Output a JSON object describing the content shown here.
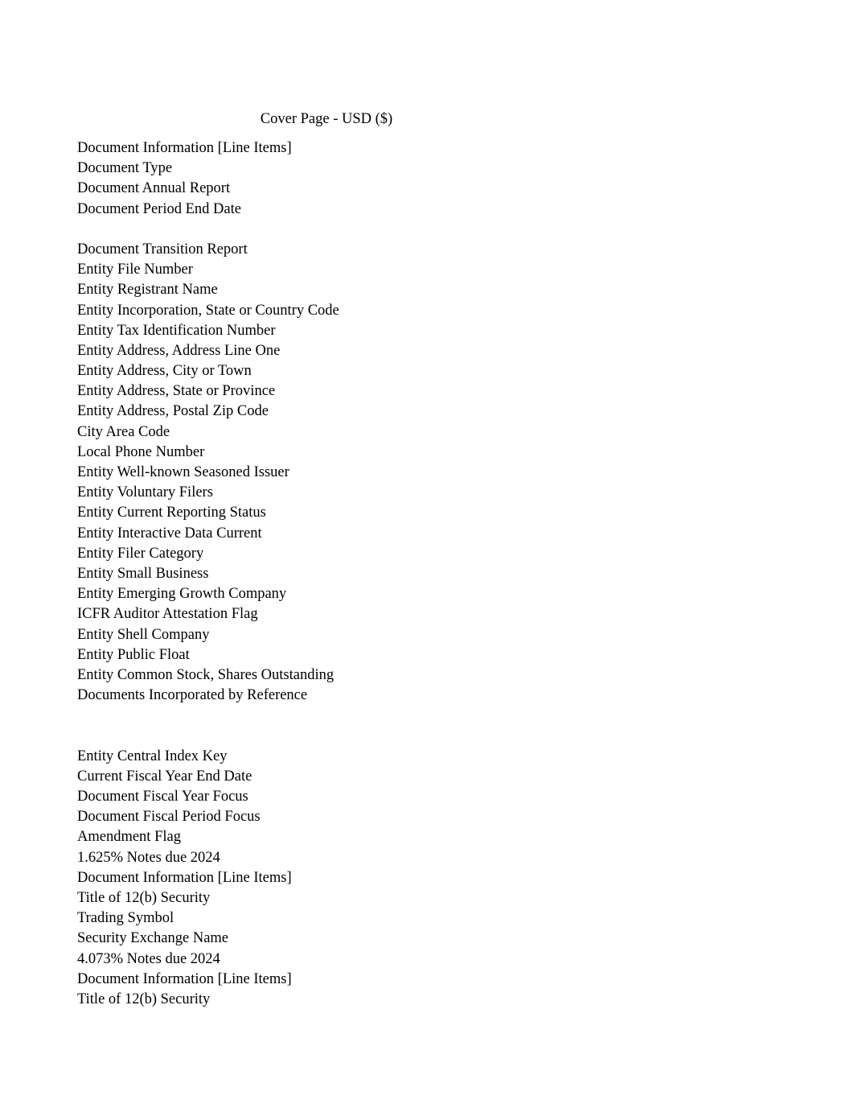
{
  "page": {
    "title": "Cover Page - USD ($)",
    "background_color": "#ffffff",
    "text_color": "#000000"
  },
  "rows": [
    {
      "label": "Document Information [Line Items]",
      "type": "label"
    },
    {
      "label": "Document Type",
      "type": "label"
    },
    {
      "label": "Document Annual Report",
      "type": "label"
    },
    {
      "label": "Document Period End Date",
      "type": "label"
    },
    {
      "label": "",
      "type": "spacer"
    },
    {
      "label": "Document Transition Report",
      "type": "label"
    },
    {
      "label": "Entity File Number",
      "type": "label"
    },
    {
      "label": "Entity Registrant Name",
      "type": "label"
    },
    {
      "label": "Entity Incorporation, State or Country Code",
      "type": "label"
    },
    {
      "label": "Entity Tax Identification Number",
      "type": "label"
    },
    {
      "label": "Entity Address, Address Line One",
      "type": "label"
    },
    {
      "label": "Entity Address, City or Town",
      "type": "label"
    },
    {
      "label": "Entity Address, State or Province",
      "type": "label"
    },
    {
      "label": "Entity Address, Postal Zip Code",
      "type": "label"
    },
    {
      "label": "City Area Code",
      "type": "label"
    },
    {
      "label": "Local Phone Number",
      "type": "label"
    },
    {
      "label": "Entity Well-known Seasoned Issuer",
      "type": "label"
    },
    {
      "label": "Entity Voluntary Filers",
      "type": "label"
    },
    {
      "label": "Entity Current Reporting Status",
      "type": "label"
    },
    {
      "label": "Entity Interactive Data Current",
      "type": "label"
    },
    {
      "label": "Entity Filer Category",
      "type": "label"
    },
    {
      "label": "Entity Small Business",
      "type": "label"
    },
    {
      "label": "Entity Emerging Growth Company",
      "type": "label"
    },
    {
      "label": "ICFR Auditor Attestation Flag",
      "type": "label"
    },
    {
      "label": "Entity Shell Company",
      "type": "label"
    },
    {
      "label": "Entity Public Float",
      "type": "label"
    },
    {
      "label": "Entity Common Stock, Shares Outstanding",
      "type": "label"
    },
    {
      "label": "Documents Incorporated by Reference",
      "type": "label"
    },
    {
      "label": "",
      "type": "spacer"
    },
    {
      "label": "",
      "type": "spacer"
    },
    {
      "label": "Entity Central Index Key",
      "type": "label"
    },
    {
      "label": "Current Fiscal Year End Date",
      "type": "label"
    },
    {
      "label": "Document Fiscal Year Focus",
      "type": "label"
    },
    {
      "label": "Document Fiscal Period Focus",
      "type": "label"
    },
    {
      "label": "Amendment Flag",
      "type": "label"
    },
    {
      "label": "1.625% Notes due 2024",
      "type": "label"
    },
    {
      "label": "Document Information [Line Items]",
      "type": "label"
    },
    {
      "label": "Title of 12(b) Security",
      "type": "label"
    },
    {
      "label": "Trading Symbol",
      "type": "label"
    },
    {
      "label": "Security Exchange Name",
      "type": "label"
    },
    {
      "label": "4.073% Notes due 2024",
      "type": "label"
    },
    {
      "label": "Document Information [Line Items]",
      "type": "label"
    },
    {
      "label": "Title of 12(b) Security",
      "type": "label"
    }
  ]
}
